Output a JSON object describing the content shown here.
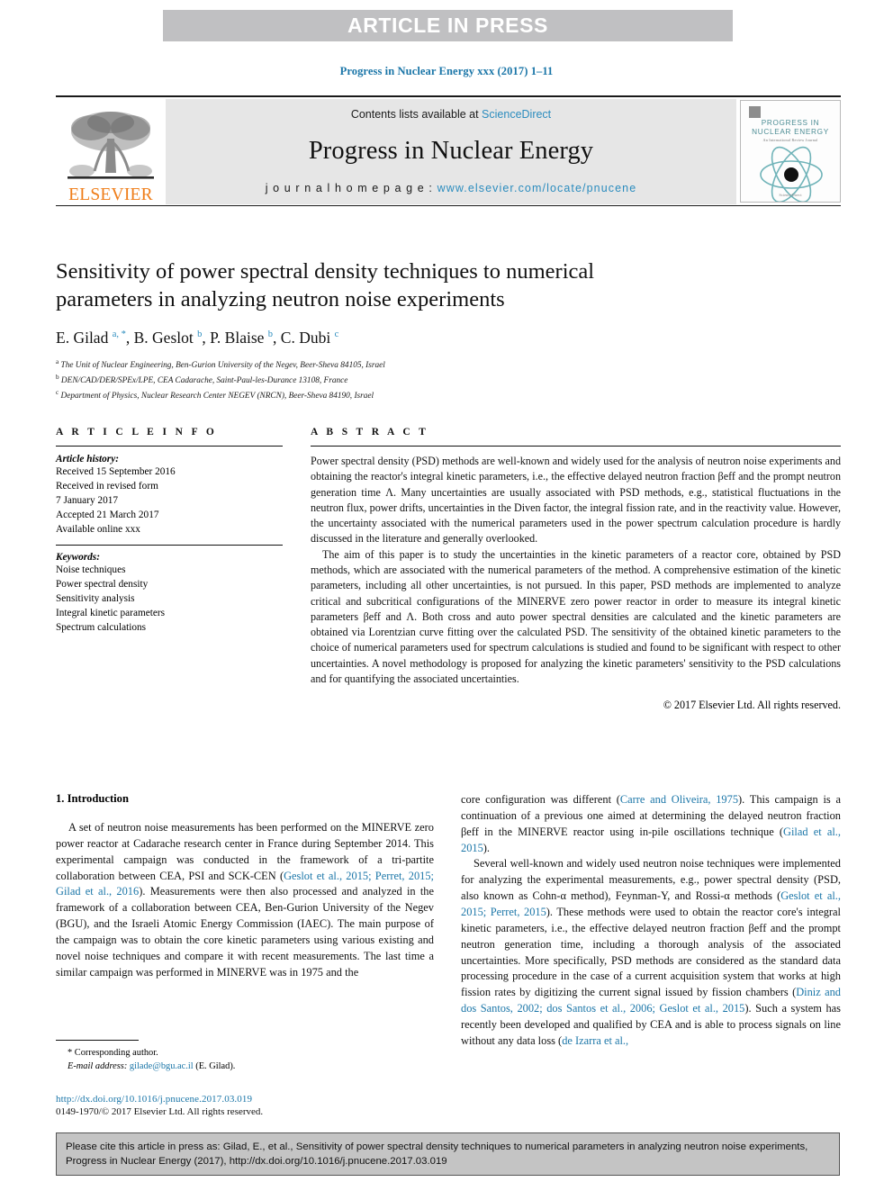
{
  "banner": {
    "text": "ARTICLE IN PRESS"
  },
  "running_head": "Progress in Nuclear Energy xxx (2017) 1–11",
  "masthead": {
    "contents_prefix": "Contents lists available at ",
    "contents_link": "ScienceDirect",
    "journal_title": "Progress in Nuclear Energy",
    "homepage_prefix": "j o u r n a l   h o m e p a g e :   ",
    "homepage_url": "www.elsevier.com/locate/pnucene",
    "publisher_logo_text": "ELSEVIER",
    "cover": {
      "line1": "PROGRESS IN",
      "line2": "NUCLEAR ENERGY",
      "subtitle": "An International Review Journal",
      "footer": "ScienceDirect"
    }
  },
  "article": {
    "title": "Sensitivity of power spectral density techniques to numerical parameters in analyzing neutron noise experiments",
    "authors": [
      {
        "name": "E. Gilad",
        "marks": "a, *"
      },
      {
        "name": "B. Geslot",
        "marks": "b"
      },
      {
        "name": "P. Blaise",
        "marks": "b"
      },
      {
        "name": "C. Dubi",
        "marks": "c"
      }
    ],
    "affiliations": [
      {
        "mark": "a",
        "text": "The Unit of Nuclear Engineering, Ben-Gurion University of the Negev, Beer-Sheva 84105, Israel"
      },
      {
        "mark": "b",
        "text": "DEN/CAD/DER/SPEx/LPE, CEA Cadarache, Saint-Paul-les-Durance 13108, France"
      },
      {
        "mark": "c",
        "text": "Department of Physics, Nuclear Research Center NEGEV (NRCN), Beer-Sheva 84190, Israel"
      }
    ]
  },
  "article_info": {
    "heading": "A R T I C L E   I N F O",
    "history_label": "Article history:",
    "history": [
      "Received 15 September 2016",
      "Received in revised form",
      "7 January 2017",
      "Accepted 21 March 2017",
      "Available online xxx"
    ],
    "keywords_label": "Keywords:",
    "keywords": [
      "Noise techniques",
      "Power spectral density",
      "Sensitivity analysis",
      "Integral kinetic parameters",
      "Spectrum calculations"
    ]
  },
  "abstract": {
    "heading": "A B S T R A C T",
    "paragraph1": "Power spectral density (PSD) methods are well-known and widely used for the analysis of neutron noise experiments and obtaining the reactor's integral kinetic parameters, i.e., the effective delayed neutron fraction βeff and the prompt neutron generation time Λ. Many uncertainties are usually associated with PSD methods, e.g., statistical fluctuations in the neutron flux, power drifts, uncertainties in the Diven factor, the integral fission rate, and in the reactivity value. However, the uncertainty associated with the numerical parameters used in the power spectrum calculation procedure is hardly discussed in the literature and generally overlooked.",
    "paragraph2": "The aim of this paper is to study the uncertainties in the kinetic parameters of a reactor core, obtained by PSD methods, which are associated with the numerical parameters of the method. A comprehensive estimation of the kinetic parameters, including all other uncertainties, is not pursued. In this paper, PSD methods are implemented to analyze critical and subcritical configurations of the MINERVE zero power reactor in order to measure its integral kinetic parameters βeff and Λ. Both cross and auto power spectral densities are calculated and the kinetic parameters are obtained via Lorentzian curve fitting over the calculated PSD. The sensitivity of the obtained kinetic parameters to the choice of numerical parameters used for spectrum calculations is studied and found to be significant with respect to other uncertainties. A novel methodology is proposed for analyzing the kinetic parameters' sensitivity to the PSD calculations and for quantifying the associated uncertainties.",
    "copyright": "© 2017 Elsevier Ltd. All rights reserved."
  },
  "introduction": {
    "heading": "1. Introduction",
    "left_p1_a": "A set of neutron noise measurements has been performed on the MINERVE zero power reactor at Cadarache research center in France during September 2014. This experimental campaign was conducted in the framework of a tri-partite collaboration between CEA, PSI and SCK-CEN (",
    "left_p1_cite1": "Geslot et al., 2015; Perret, 2015; Gilad et al., 2016",
    "left_p1_b": "). Measurements were then also processed and analyzed in the framework of a collaboration between CEA, Ben-Gurion University of the Negev (BGU), and the Israeli Atomic Energy Commission (IAEC). The main purpose of the campaign was to obtain the core kinetic parameters using various existing and novel noise techniques and compare it with recent measurements. The last time a similar campaign was performed in MINERVE was in 1975 and the",
    "right_p1_a": "core configuration was different (",
    "right_p1_cite1": "Carre and Oliveira, 1975",
    "right_p1_b": "). This campaign is a continuation of a previous one aimed at determining the delayed neutron fraction βeff in the MINERVE reactor using in-pile oscillations technique (",
    "right_p1_cite2": "Gilad et al., 2015",
    "right_p1_c": ").",
    "right_p2_a": "Several well-known and widely used neutron noise techniques were implemented for analyzing the experimental measurements, e.g., power spectral density (PSD, also known as Cohn-α method), Feynman-Y, and Rossi-α methods (",
    "right_p2_cite1": "Geslot et al., 2015; Perret, 2015",
    "right_p2_b": "). These methods were used to obtain the reactor core's integral kinetic parameters, i.e., the effective delayed neutron fraction βeff and the prompt neutron generation time, including a thorough analysis of the associated uncertainties. More specifically, PSD methods are considered as the standard data processing procedure in the case of a current acquisition system that works at high fission rates by digitizing the current signal issued by fission chambers (",
    "right_p2_cite2": "Diniz and dos Santos, 2002; dos Santos et al., 2006; Geslot et al., 2015",
    "right_p2_c": "). Such a system has recently been developed and qualified by CEA and is able to process signals on line without any data loss (",
    "right_p2_cite3": "de Izarra et al.,"
  },
  "footnote": {
    "corresponding": "* Corresponding author.",
    "email_label": "E-mail address:",
    "email": "gilade@bgu.ac.il",
    "email_suffix": "(E. Gilad).",
    "doi": "http://dx.doi.org/10.1016/j.pnucene.2017.03.019",
    "issn": "0149-1970/© 2017 Elsevier Ltd. All rights reserved."
  },
  "cite_box": {
    "text": "Please cite this article in press as: Gilad, E., et al., Sensitivity of power spectral density techniques to numerical parameters in analyzing neutron noise experiments, Progress in Nuclear Energy (2017), http://dx.doi.org/10.1016/j.pnucene.2017.03.019"
  }
}
